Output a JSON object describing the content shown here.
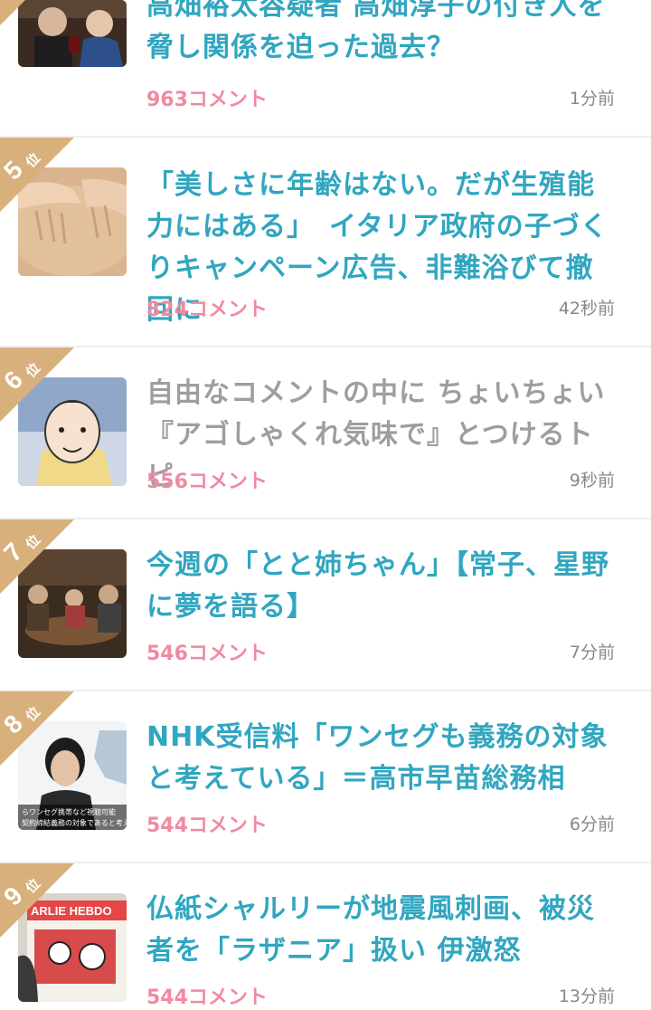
{
  "ranking": {
    "items": [
      {
        "rank": "",
        "rank_label": "",
        "title": "高畑裕太容疑者 高畑淳子の付き人を脅し関係を迫った過去？",
        "comments": "963コメント",
        "time": "1分前",
        "visited": false
      },
      {
        "rank": "5",
        "rank_label": "位",
        "title": "「美しさに年齢はない。だが生殖能力にはある」　イタリア政府の子づくりキャンペーン広告、非難浴びて撤回に",
        "comments": "824コメント",
        "time": "42秒前",
        "visited": false
      },
      {
        "rank": "6",
        "rank_label": "位",
        "title": "自由なコメントの中に ちょいちょい『アゴしゃくれ気味で』とつけるトピ",
        "comments": "556コメント",
        "time": "9秒前",
        "visited": true
      },
      {
        "rank": "7",
        "rank_label": "位",
        "title": "今週の「とと姉ちゃん」【常子、星野に夢を語る】",
        "comments": "546コメント",
        "time": "7分前",
        "visited": false
      },
      {
        "rank": "8",
        "rank_label": "位",
        "title": "NHK受信料「ワンセグも義務の対象と考えている」＝高市早苗総務相",
        "comments": "544コメント",
        "time": "6分前",
        "visited": false
      },
      {
        "rank": "9",
        "rank_label": "位",
        "title": "仏紙シャルリーが地震風刺画、被災者を「ラザニア」扱い 伊激怒",
        "comments": "544コメント",
        "time": "13分前",
        "visited": false
      }
    ],
    "thumbnail_text": {
      "item4": "らワンセグ携帯など視聴可能…契約締結義務の対象であると考えて",
      "item5": "ARLIE HEBDO"
    }
  },
  "colors": {
    "title": "#31a6c0",
    "title_visited": "#9e9e9e",
    "comments": "#f08aa0",
    "time": "#888888",
    "rank_badge": "#d8b07c",
    "divider": "#eeeeee"
  },
  "icons": {
    "rank_badge": "rank-ribbon-icon"
  }
}
